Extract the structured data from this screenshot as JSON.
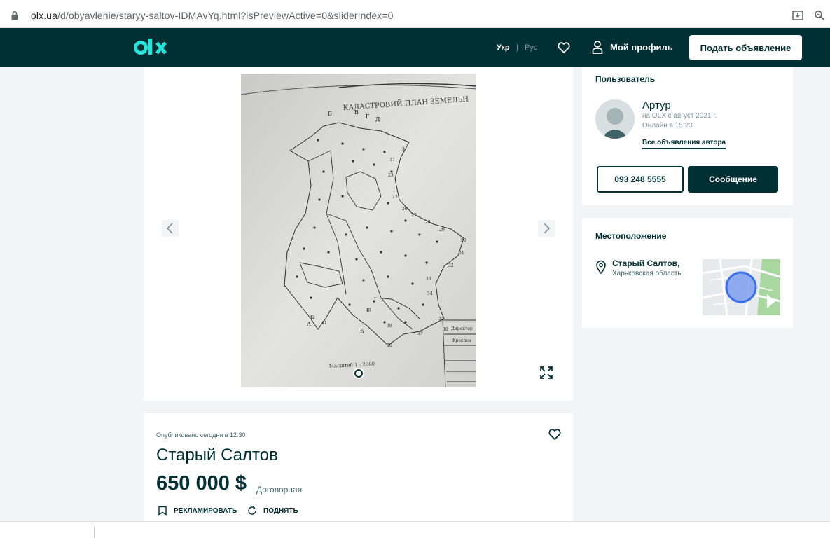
{
  "browser": {
    "url_domain": "olx.ua",
    "url_path": "/d/obyavlenie/staryy-saltov-IDMAvYq.html?isPreviewActive=0&sliderIndex=0"
  },
  "header": {
    "logo": "olx",
    "lang_ukr": "Укр",
    "lang_sep": "|",
    "lang_rus": "Рус",
    "profile_label": "Мой профиль",
    "post_button_label": "Подать объявление",
    "colors": {
      "background": "#002f34",
      "logo_accent": "#23e5db"
    }
  },
  "gallery": {
    "photo_title": "КАДАСТРОВИЙ ПЛАН ЗЕМЕЛЬН",
    "photo_scale": "Масштаб 1 : 2000",
    "stamp_lines": [
      "Директор",
      "Креслев"
    ]
  },
  "listing": {
    "published": "Опубликовано сегодня в 12:30",
    "title": "Старый Салтов",
    "price": "650 000 $",
    "negotiable": "Договорная",
    "promote_label": "РЕКЛАМИРОВАТЬ",
    "raise_label": "ПОДНЯТЬ"
  },
  "user": {
    "section_title": "Пользователь",
    "name": "Артур",
    "since": "на OLX с август 2021 г.",
    "online": "Онлайн в 15:23",
    "all_ads_link": "Все объявления автора",
    "phone": "093 248 5555",
    "message_button": "Сообщение"
  },
  "location": {
    "section_title": "Местоположение",
    "city": "Старый Салтов,",
    "region": "Харьковская область"
  }
}
